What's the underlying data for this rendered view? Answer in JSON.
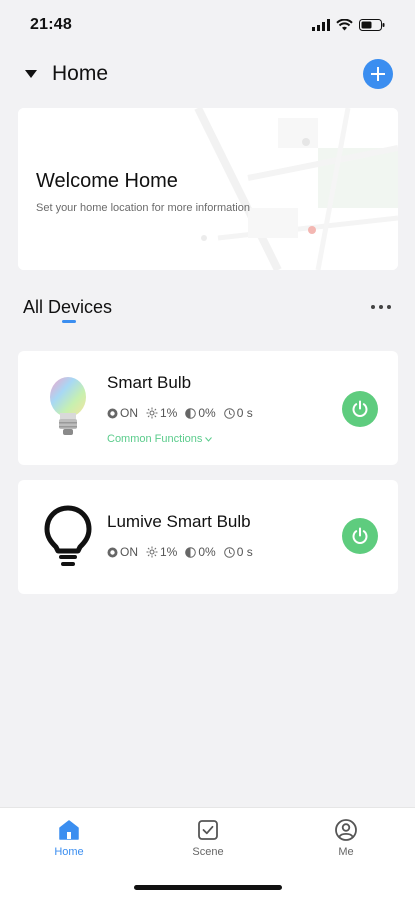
{
  "status": {
    "time": "21:48"
  },
  "header": {
    "title": "Home"
  },
  "welcome": {
    "title": "Welcome Home",
    "subtitle": "Set your home location for more information"
  },
  "section": {
    "title": "All Devices"
  },
  "devices": [
    {
      "name": "Smart Bulb",
      "state": "ON",
      "brightness": "1%",
      "color_temp": "0%",
      "timer": "0 s",
      "common_functions": "Common Functions",
      "icon": "smart-bulb-image"
    },
    {
      "name": "Lumive Smart Bulb",
      "state": "ON",
      "brightness": "1%",
      "color_temp": "0%",
      "timer": "0 s",
      "icon": "lightbulb-outline-icon"
    }
  ],
  "tabs": [
    {
      "label": "Home",
      "icon": "home-icon",
      "active": true
    },
    {
      "label": "Scene",
      "icon": "scene-icon",
      "active": false
    },
    {
      "label": "Me",
      "icon": "profile-icon",
      "active": false
    }
  ],
  "colors": {
    "accent": "#3b8ef0",
    "power_on": "#5ecc7e",
    "link_green": "#5bcc8c",
    "background": "#f2f2f4"
  }
}
